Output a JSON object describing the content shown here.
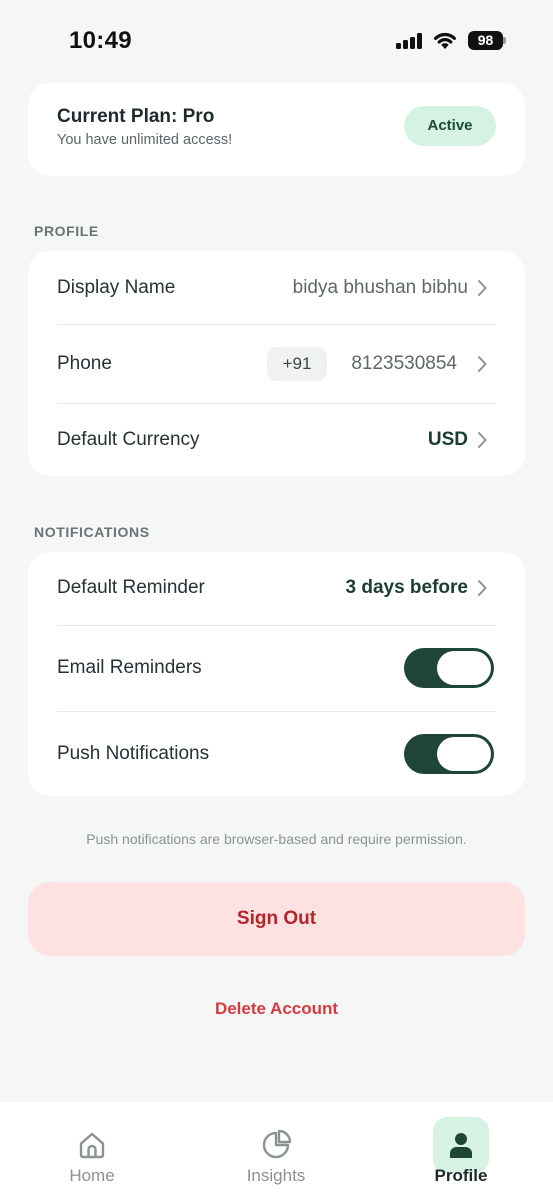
{
  "status_bar": {
    "time": "10:49",
    "battery": "98"
  },
  "plan": {
    "title": "Current Plan: Pro",
    "subtitle": "You have unlimited access!",
    "badge": "Active"
  },
  "profile": {
    "section_label": "PROFILE",
    "display_name": {
      "label": "Display Name",
      "value": "bidya bhushan bibhu"
    },
    "phone": {
      "label": "Phone",
      "country_code": "+91",
      "value": "8123530854"
    },
    "currency": {
      "label": "Default Currency",
      "value": "USD"
    }
  },
  "notifications": {
    "section_label": "NOTIFICATIONS",
    "default_reminder": {
      "label": "Default Reminder",
      "value": "3 days before"
    },
    "email_reminders": {
      "label": "Email Reminders",
      "enabled": true
    },
    "push_notifications": {
      "label": "Push Notifications",
      "enabled": true
    },
    "footnote": "Push notifications are browser-based and require permission."
  },
  "actions": {
    "sign_out": "Sign Out",
    "delete_account": "Delete Account"
  },
  "tabs": [
    {
      "label": "Home",
      "icon": "home-icon",
      "active": false
    },
    {
      "label": "Insights",
      "icon": "pie-chart-icon",
      "active": false
    },
    {
      "label": "Profile",
      "icon": "user-icon",
      "active": true
    }
  ],
  "colors": {
    "background": "#f4f7f6",
    "accent_green": "#1e4535",
    "badge_green_bg": "#d5f2e3",
    "danger": "#b42529",
    "danger_bg": "#fde2e1"
  }
}
